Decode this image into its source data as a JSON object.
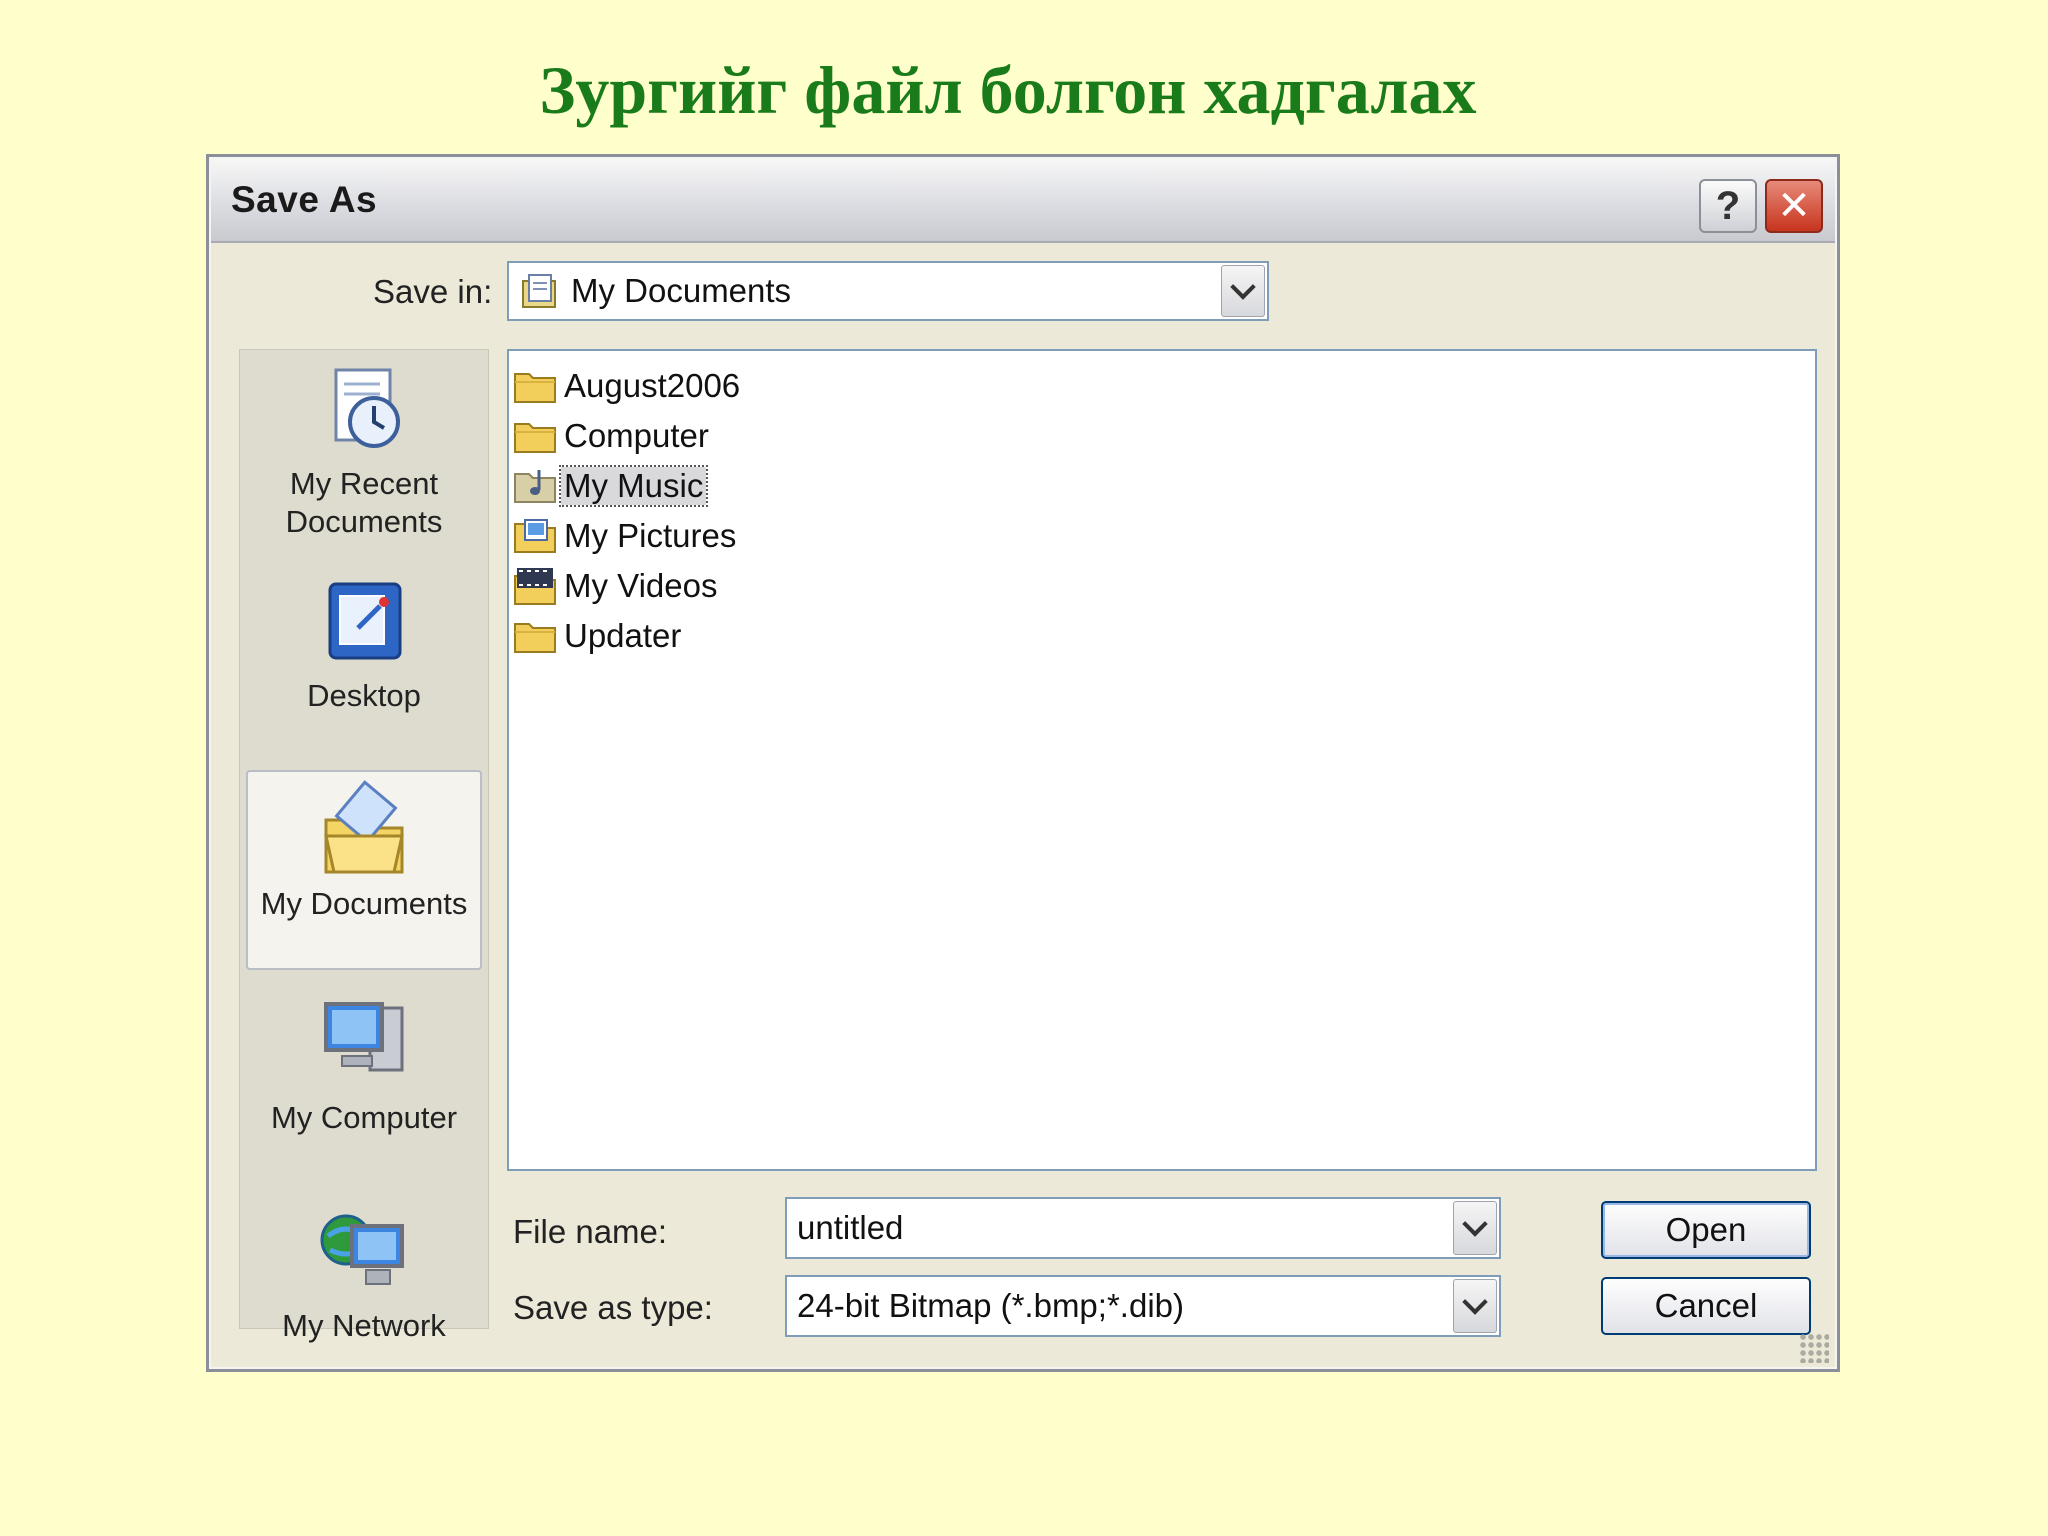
{
  "slide": {
    "title": "Зургийг файл болгон хадгалах"
  },
  "dialog": {
    "title": "Save As",
    "help_label": "?",
    "close_label": "✕",
    "save_in": {
      "label": "Save in:",
      "value": "My Documents"
    },
    "toolbar": [
      "back-icon",
      "up-folder-icon",
      "new-folder-icon",
      "views-menu-icon"
    ],
    "places": [
      {
        "label": "My Recent Documents",
        "icon": "recent-documents-icon"
      },
      {
        "label": "Desktop",
        "icon": "desktop-icon"
      },
      {
        "label": "My Documents",
        "icon": "my-documents-icon",
        "selected": true
      },
      {
        "label": "My Computer",
        "icon": "my-computer-icon"
      },
      {
        "label": "My Network",
        "icon": "my-network-icon"
      }
    ],
    "files": [
      {
        "name": "August2006",
        "icon": "folder-icon"
      },
      {
        "name": "Computer",
        "icon": "folder-icon"
      },
      {
        "name": "My Music",
        "icon": "music-folder-icon",
        "focused": true
      },
      {
        "name": "My Pictures",
        "icon": "pictures-folder-icon"
      },
      {
        "name": "My Videos",
        "icon": "videos-folder-icon"
      },
      {
        "name": "Updater",
        "icon": "folder-icon"
      }
    ],
    "file_name": {
      "label": "File name:",
      "value": "untitled"
    },
    "save_type": {
      "label": "Save as type:",
      "value": "24-bit Bitmap (*.bmp;*.dib)"
    },
    "buttons": {
      "open": "Open",
      "cancel": "Cancel"
    }
  }
}
